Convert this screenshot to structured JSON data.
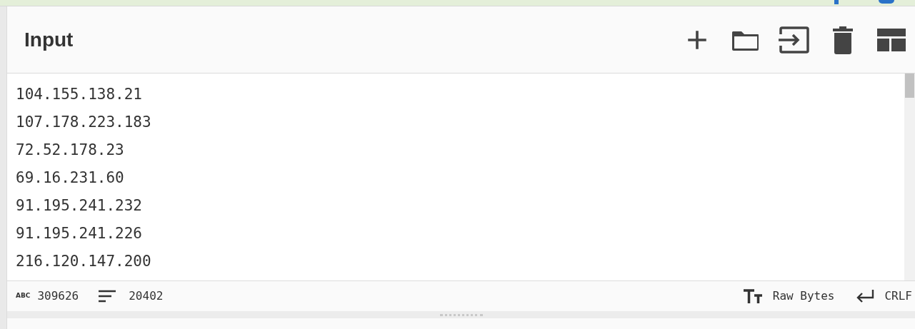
{
  "panel": {
    "title": "Input"
  },
  "lines": [
    "104.155.138.21",
    "107.178.223.183",
    "72.52.178.23",
    "69.16.231.60",
    "91.195.241.232",
    "91.195.241.226",
    "216.120.147.200"
  ],
  "status_bar": {
    "length_icon": "ABC",
    "length": "309626",
    "line_count": "20402",
    "encoding": "Raw Bytes",
    "eol": "CRLF"
  }
}
